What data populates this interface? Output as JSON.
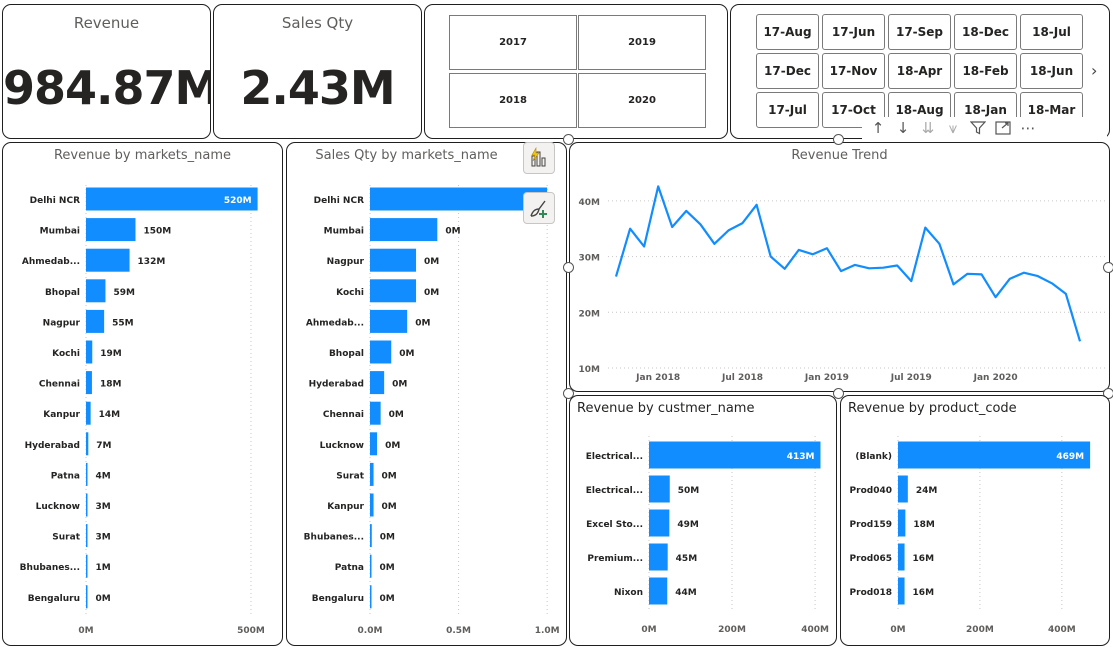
{
  "kpis": {
    "revenue": {
      "label": "Revenue",
      "value": "984.87M"
    },
    "sales_qty": {
      "label": "Sales Qty",
      "value": "2.43M"
    }
  },
  "year_slicer": {
    "years": [
      "2017",
      "2019",
      "2018",
      "2020"
    ]
  },
  "month_slicer": {
    "items": [
      "17-Aug",
      "17-Jun",
      "17-Sep",
      "18-Dec",
      "18-Jul",
      "17-Dec",
      "17-Nov",
      "18-Apr",
      "18-Feb",
      "18-Jun",
      "17-Jul",
      "17-Oct",
      "18-Aug",
      "18-Jan",
      "18-Mar"
    ],
    "next_icon": "chevron-right-icon"
  },
  "visual_toolbar": {
    "icons": [
      "arrow-up-icon",
      "arrow-down-icon",
      "double-arrow-down-icon",
      "expand-hierarchy-icon",
      "filter-icon",
      "focus-mode-icon",
      "more-options-icon"
    ]
  },
  "side_buttons": {
    "icons": [
      "quick-insights-icon",
      "format-brush-icon"
    ]
  },
  "chart_data": [
    {
      "id": "revenue_by_market",
      "type": "bar",
      "orientation": "horizontal",
      "title": "Revenue by markets_name",
      "categories": [
        "Delhi NCR",
        "Mumbai",
        "Ahmedab...",
        "Bhopal",
        "Nagpur",
        "Kochi",
        "Chennai",
        "Kanpur",
        "Hyderabad",
        "Patna",
        "Lucknow",
        "Surat",
        "Bhubanes...",
        "Bengaluru"
      ],
      "values": [
        520,
        150,
        132,
        59,
        55,
        19,
        18,
        14,
        7,
        4,
        3,
        3,
        1,
        0
      ],
      "labels": [
        "520M",
        "150M",
        "132M",
        "59M",
        "55M",
        "19M",
        "18M",
        "14M",
        "7M",
        "4M",
        "3M",
        "3M",
        "1M",
        "0M"
      ],
      "xlim": [
        0,
        600
      ],
      "xticks": [
        0,
        500
      ],
      "xtick_labels": [
        "0M",
        "500M"
      ],
      "grid": true,
      "color": "#118DFF"
    },
    {
      "id": "sales_qty_by_market",
      "type": "bar",
      "orientation": "horizontal",
      "title": "Sales Qty by markets_name",
      "categories": [
        "Delhi NCR",
        "Mumbai",
        "Nagpur",
        "Kochi",
        "Ahmedab...",
        "Bhopal",
        "Hyderabad",
        "Chennai",
        "Lucknow",
        "Surat",
        "Kanpur",
        "Bhubanes...",
        "Patna",
        "Bengaluru"
      ],
      "values": [
        1.0,
        0.38,
        0.26,
        0.26,
        0.21,
        0.12,
        0.08,
        0.06,
        0.04,
        0.02,
        0.02,
        0.01,
        0.005,
        0.003
      ],
      "labels": [
        "1M",
        "0M",
        "0M",
        "0M",
        "0M",
        "0M",
        "0M",
        "0M",
        "0M",
        "0M",
        "0M",
        "0M",
        "0M",
        "0M"
      ],
      "xlim": [
        0,
        1.05
      ],
      "xticks": [
        0,
        0.5,
        1.0
      ],
      "xtick_labels": [
        "0.0M",
        "0.5M",
        "1.0M"
      ],
      "grid": true,
      "color": "#118DFF"
    },
    {
      "id": "revenue_trend",
      "type": "line",
      "title": "Revenue Trend",
      "x": [
        "2017-10",
        "2017-11",
        "2017-12",
        "2018-01",
        "2018-02",
        "2018-03",
        "2018-04",
        "2018-05",
        "2018-06",
        "2018-07",
        "2018-08",
        "2018-09",
        "2018-10",
        "2018-11",
        "2018-12",
        "2019-01",
        "2019-02",
        "2019-03",
        "2019-04",
        "2019-05",
        "2019-06",
        "2019-07",
        "2019-08",
        "2019-09",
        "2019-10",
        "2019-11",
        "2019-12",
        "2020-01",
        "2020-02",
        "2020-03",
        "2020-04",
        "2020-05",
        "2020-06"
      ],
      "y": [
        26.4,
        35.0,
        31.8,
        42.6,
        35.3,
        38.2,
        35.8,
        32.3,
        34.7,
        36.0,
        39.3,
        30.0,
        27.8,
        31.2,
        30.4,
        31.5,
        27.4,
        28.5,
        27.9,
        28.0,
        28.4,
        25.6,
        35.2,
        32.3,
        25.0,
        26.9,
        26.8,
        22.7,
        26.0,
        27.1,
        26.5,
        25.2,
        23.3,
        14.8
      ],
      "xticks": [
        "2018-01",
        "2018-07",
        "2019-01",
        "2019-07",
        "2020-01"
      ],
      "xtick_labels": [
        "Jan 2018",
        "Jul 2018",
        "Jan 2019",
        "Jul 2019",
        "Jan 2020"
      ],
      "ylim": [
        10,
        45
      ],
      "yticks": [
        10,
        20,
        30,
        40
      ],
      "ytick_labels": [
        "10M",
        "20M",
        "30M",
        "40M"
      ],
      "grid": true,
      "color": "#118DFF"
    },
    {
      "id": "revenue_by_customer",
      "type": "bar",
      "orientation": "horizontal",
      "title": "Revenue by custmer_name",
      "categories": [
        "Electrical...",
        "Electrical...",
        "Excel Sto...",
        "Premium...",
        "Nixon"
      ],
      "values": [
        413,
        50,
        49,
        45,
        44
      ],
      "labels": [
        "413M",
        "50M",
        "49M",
        "45M",
        "44M"
      ],
      "xlim": [
        0,
        460
      ],
      "xticks": [
        0,
        200,
        400
      ],
      "xtick_labels": [
        "0M",
        "200M",
        "400M"
      ],
      "grid": true,
      "color": "#118DFF"
    },
    {
      "id": "revenue_by_product",
      "type": "bar",
      "orientation": "horizontal",
      "title": "Revenue by product_code",
      "categories": [
        "(Blank)",
        "Prod040",
        "Prod159",
        "Prod065",
        "Prod018"
      ],
      "values": [
        469,
        24,
        18,
        16,
        16
      ],
      "labels": [
        "469M",
        "24M",
        "18M",
        "16M",
        "16M"
      ],
      "xlim": [
        0,
        520
      ],
      "xticks": [
        0,
        200,
        400
      ],
      "xtick_labels": [
        "0M",
        "200M",
        "400M"
      ],
      "grid": true,
      "color": "#118DFF"
    }
  ]
}
